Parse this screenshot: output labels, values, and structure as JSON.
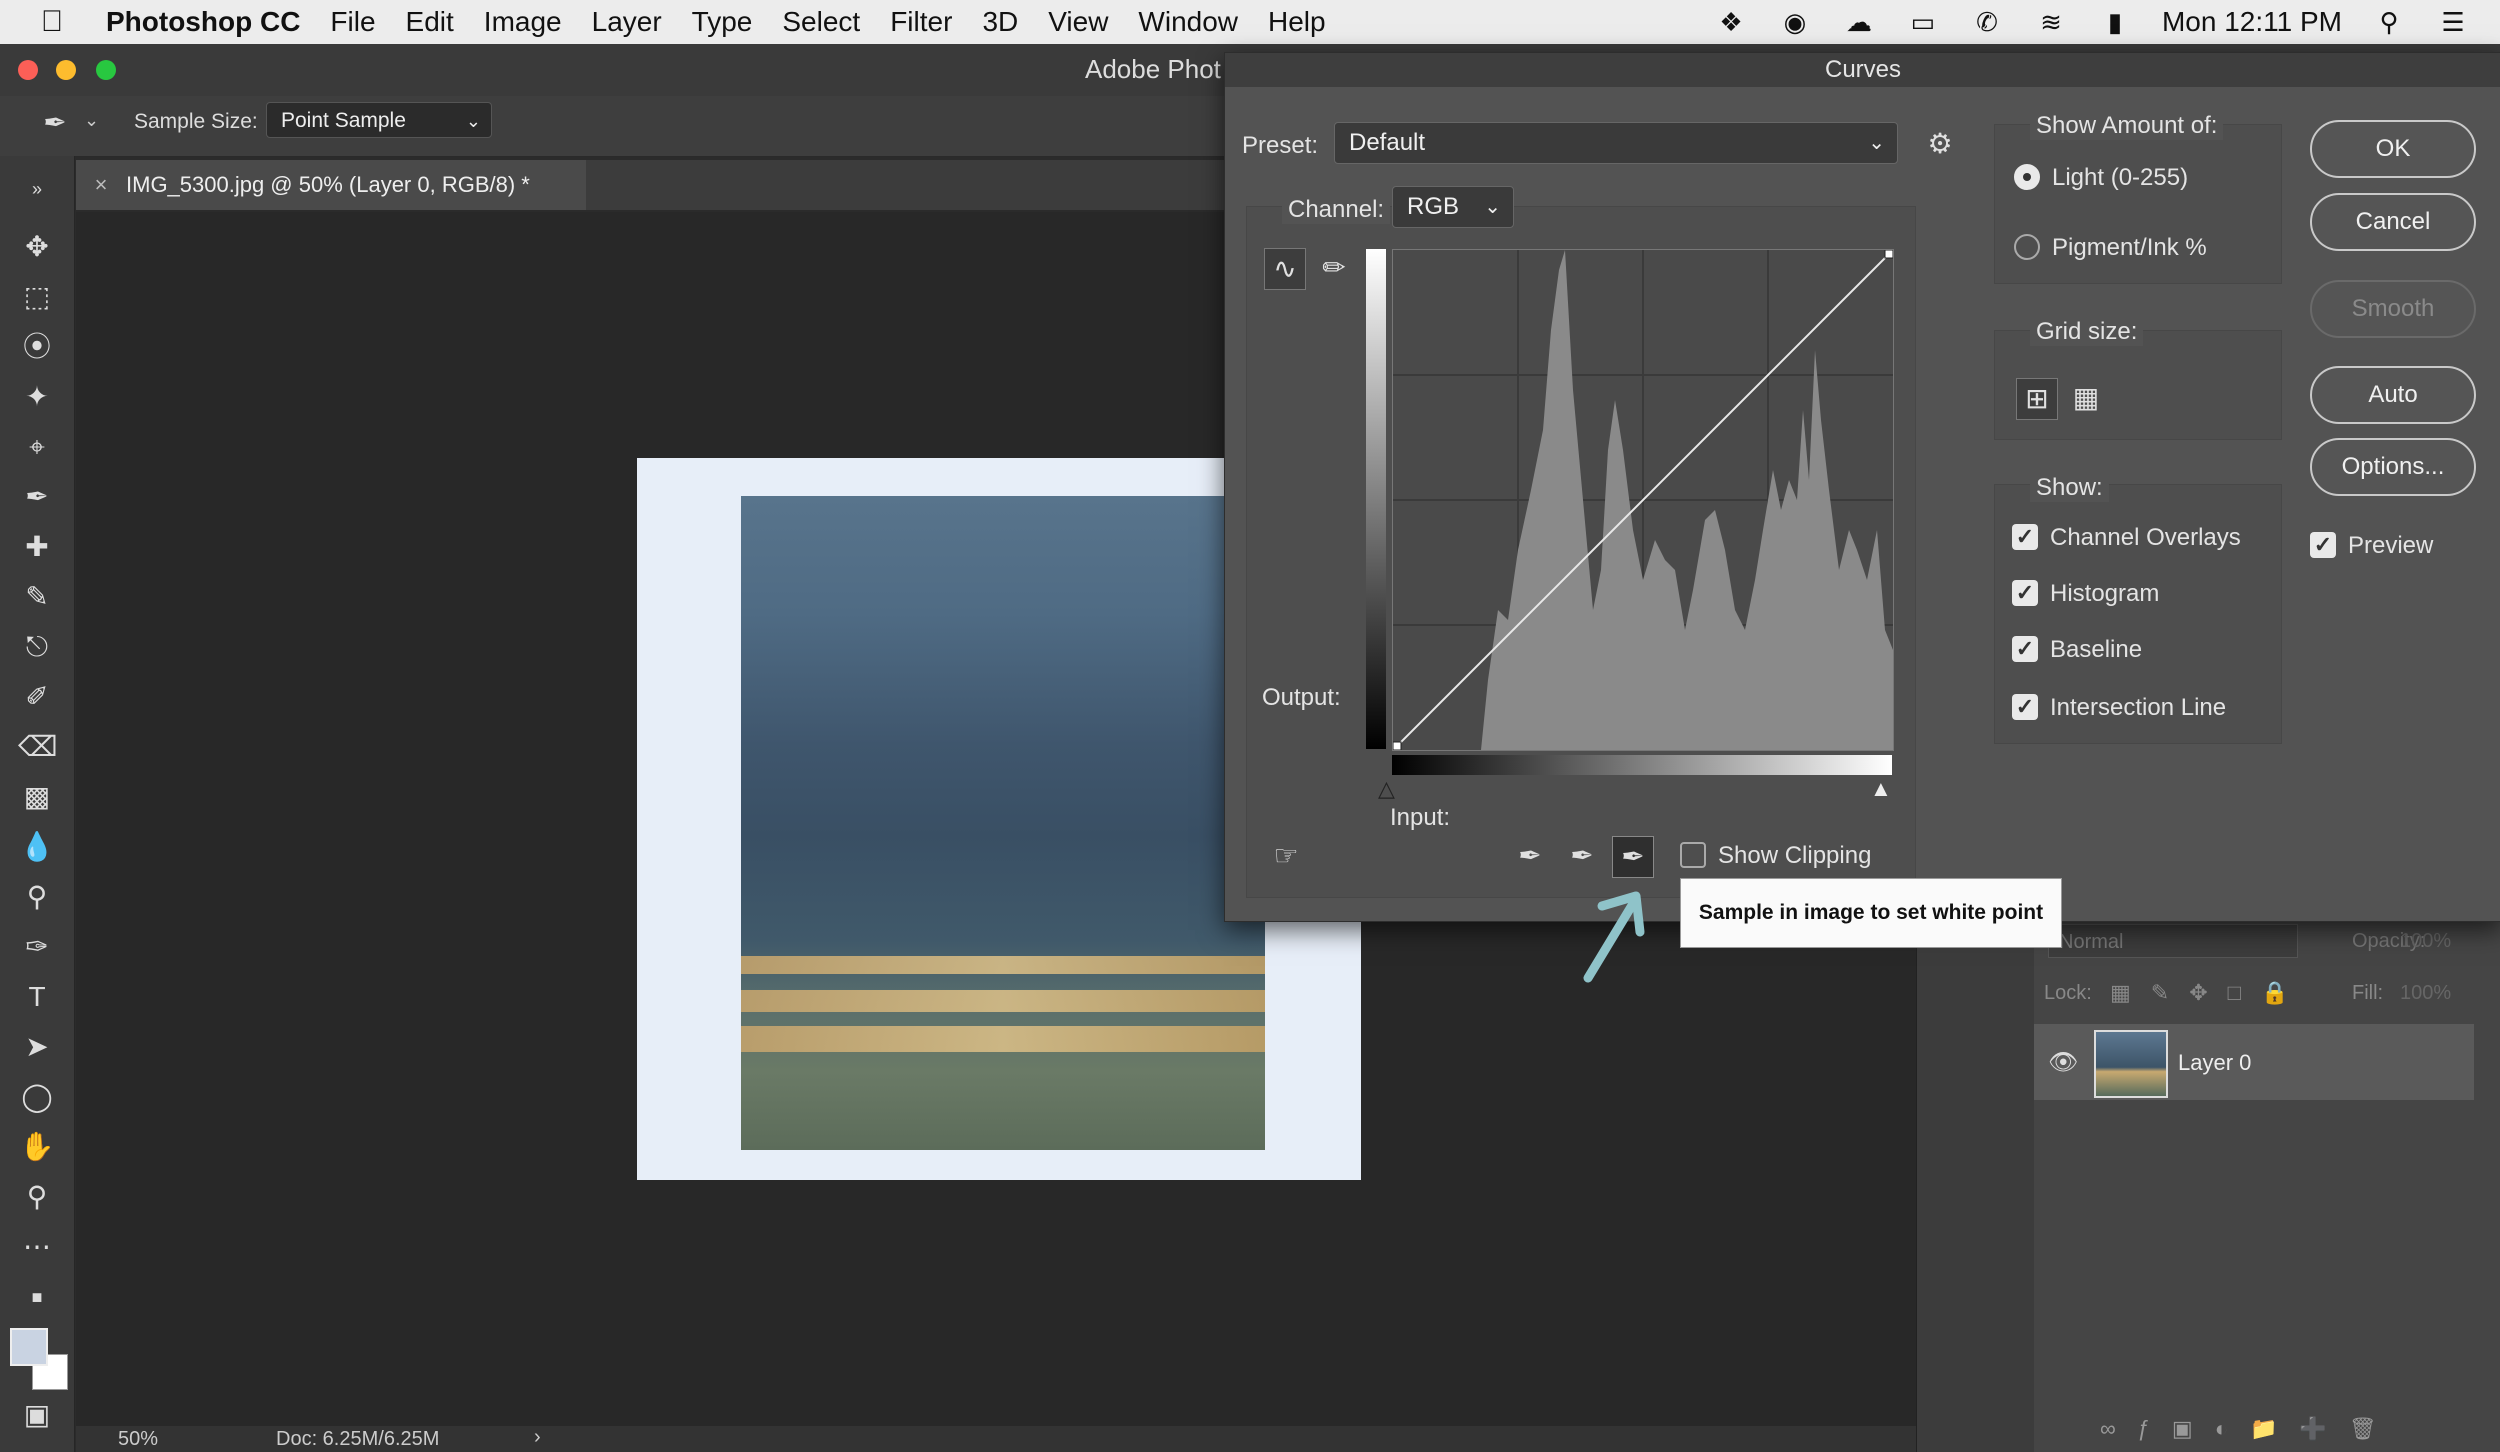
{
  "menubar": {
    "app_name": "Photoshop CC",
    "items": [
      "File",
      "Edit",
      "Image",
      "Layer",
      "Type",
      "Select",
      "Filter",
      "3D",
      "View",
      "Window",
      "Help"
    ],
    "clock": "Mon 12:11 PM"
  },
  "window": {
    "title": "Adobe Phot"
  },
  "options_bar": {
    "sample_size_label": "Sample Size:",
    "sample_size_value": "Point Sample"
  },
  "document": {
    "tab_title": "IMG_5300.jpg @ 50% (Layer 0, RGB/8) *",
    "close_glyph": "×"
  },
  "status": {
    "zoom": "50%",
    "doc_size": "Doc: 6.25M/6.25M",
    "arrow": "›"
  },
  "layers": {
    "blend_mode": "Normal",
    "opacity_label": "Opacity:",
    "opacity_value": "100%",
    "lock_label": "Lock:",
    "fill_label": "Fill:",
    "fill_value": "100%",
    "layer_name": "Layer 0"
  },
  "curves": {
    "title": "Curves",
    "preset_label": "Preset:",
    "preset_value": "Default",
    "channel_label": "Channel:",
    "channel_value": "RGB",
    "output_label": "Output:",
    "input_label": "Input:",
    "show_clipping_label": "Show Clipping",
    "show_clipping_checked": false,
    "show_amount_label": "Show Amount of:",
    "light_label": "Light  (0-255)",
    "pigment_label": "Pigment/Ink %",
    "grid_size_label": "Grid size:",
    "show_label": "Show:",
    "show_options": [
      {
        "label": "Channel Overlays",
        "checked": true
      },
      {
        "label": "Histogram",
        "checked": true
      },
      {
        "label": "Baseline",
        "checked": true
      },
      {
        "label": "Intersection Line",
        "checked": true
      }
    ],
    "buttons": {
      "ok": "OK",
      "cancel": "Cancel",
      "smooth": "Smooth",
      "auto": "Auto",
      "options": "Options..."
    },
    "preview_label": "Preview",
    "preview_checked": true,
    "tooltip": "Sample in image to set white point"
  },
  "colors": {
    "accent_arrow": "#8fc3c9",
    "dialog_bg": "#535353",
    "canvas_bg": "#282828"
  }
}
